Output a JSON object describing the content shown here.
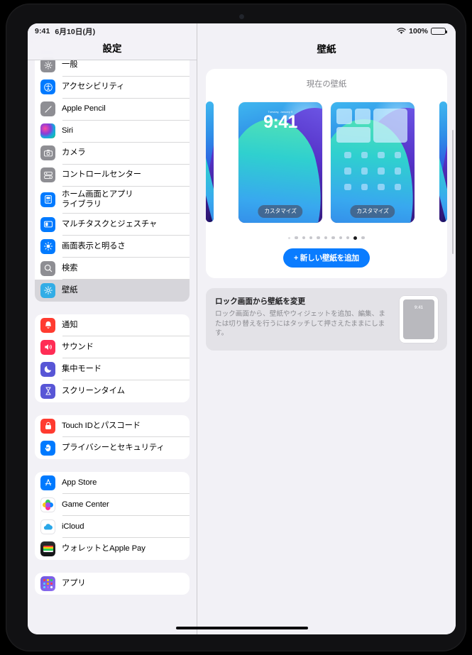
{
  "status_bar": {
    "time": "9:41",
    "date": "6月10日(月)",
    "battery_percent": "100%",
    "wifi_icon": "wifi-icon",
    "battery_icon": "battery-icon"
  },
  "sidebar": {
    "title": "設定",
    "groups": [
      {
        "items": [
          {
            "label": "一般",
            "icon": "gear-icon",
            "color": "#8e8e93",
            "selected": false
          },
          {
            "label": "アクセシビリティ",
            "icon": "accessibility-icon",
            "color": "#007aff",
            "selected": false
          },
          {
            "label": "Apple Pencil",
            "icon": "pencil-icon",
            "color": "#8e8e93",
            "selected": false
          },
          {
            "label": "Siri",
            "icon": "siri-icon",
            "color": "#1e1e22",
            "selected": false
          },
          {
            "label": "カメラ",
            "icon": "camera-icon",
            "color": "#8e8e93",
            "selected": false
          },
          {
            "label": "コントロールセンター",
            "icon": "sliders-icon",
            "color": "#8e8e93",
            "selected": false
          },
          {
            "label": "ホーム画面とアプリ\nライブラリ",
            "icon": "home-screen-icon",
            "color": "#007aff",
            "selected": false
          },
          {
            "label": "マルチタスクとジェスチャ",
            "icon": "multitasking-icon",
            "color": "#007aff",
            "selected": false
          },
          {
            "label": "画面表示と明るさ",
            "icon": "brightness-icon",
            "color": "#007aff",
            "selected": false
          },
          {
            "label": "検索",
            "icon": "search-icon",
            "color": "#8e8e93",
            "selected": false
          },
          {
            "label": "壁紙",
            "icon": "wallpaper-icon",
            "color": "#32ade6",
            "selected": true
          }
        ]
      },
      {
        "items": [
          {
            "label": "通知",
            "icon": "bell-icon",
            "color": "#ff3b30",
            "selected": false
          },
          {
            "label": "サウンド",
            "icon": "speaker-icon",
            "color": "#ff2d55",
            "selected": false
          },
          {
            "label": "集中モード",
            "icon": "moon-icon",
            "color": "#5856d6",
            "selected": false
          },
          {
            "label": "スクリーンタイム",
            "icon": "hourglass-icon",
            "color": "#5856d6",
            "selected": false
          }
        ]
      },
      {
        "items": [
          {
            "label": "Touch IDとパスコード",
            "icon": "lock-icon",
            "color": "#ff3b30",
            "selected": false
          },
          {
            "label": "プライバシーとセキュリティ",
            "icon": "hand-icon",
            "color": "#007aff",
            "selected": false
          }
        ]
      },
      {
        "items": [
          {
            "label": "App Store",
            "icon": "app-store-icon",
            "color": "#0a84ff",
            "selected": false
          },
          {
            "label": "Game Center",
            "icon": "game-center-icon",
            "color": "#ffffff",
            "selected": false
          },
          {
            "label": "iCloud",
            "icon": "icloud-icon",
            "color": "#ffffff",
            "selected": false
          },
          {
            "label": "ウォレットとApple Pay",
            "icon": "wallet-icon",
            "color": "#1c1c1e",
            "selected": false
          }
        ]
      },
      {
        "items": [
          {
            "label": "アプリ",
            "icon": "apps-grid-icon",
            "color": "#7d55d6",
            "selected": false
          }
        ]
      }
    ]
  },
  "detail": {
    "title": "壁紙",
    "current_wallpaper": {
      "heading": "現在の壁紙",
      "lock_screen": {
        "date": "Tuesday, January 9",
        "time": "9:41",
        "customize_label": "カスタマイズ"
      },
      "home_screen": {
        "customize_label": "カスタマイズ"
      },
      "page_dots": {
        "total": 11,
        "active_index": 9
      },
      "add_button_label": "+ 新しい壁紙を追加",
      "add_button_color": "#0a7cff"
    },
    "info_card": {
      "title": "ロック画面から壁紙を変更",
      "description": "ロック画面から、壁紙やウィジェットを追加、編集、または切り替えを行うにはタッチして押さえたままにします。",
      "thumbnail_time": "9:41"
    }
  }
}
